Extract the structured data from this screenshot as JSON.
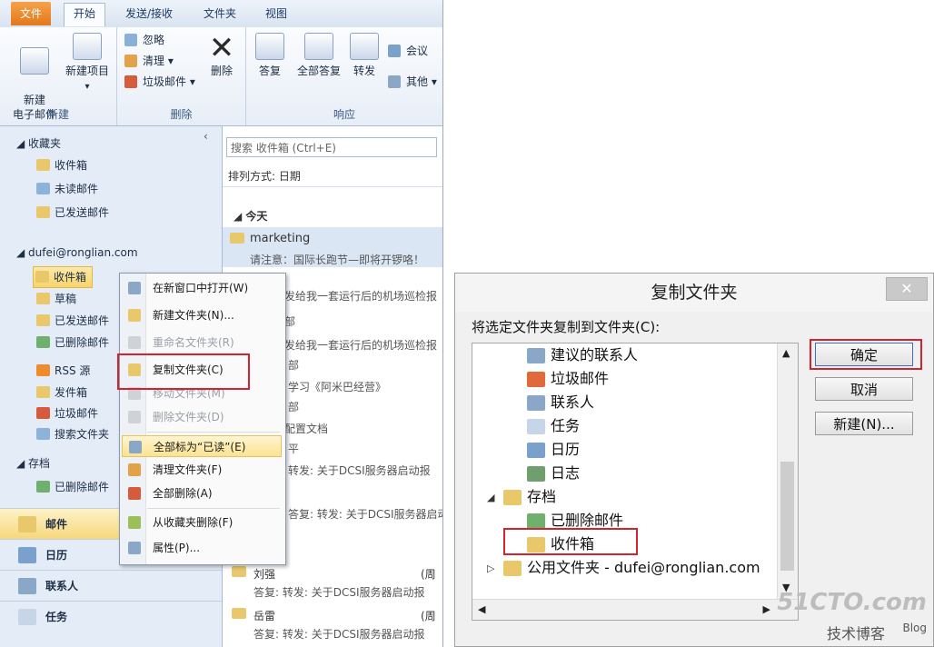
{
  "ribbon": {
    "tabs": [
      "文件",
      "开始",
      "发送/接收",
      "文件夹",
      "视图"
    ],
    "groups": {
      "new": {
        "label": "新建",
        "new_email": "新建\n电子邮件",
        "new_items": "新建项目"
      },
      "delete": {
        "label": "删除",
        "ignore": "忽略",
        "clean": "清理",
        "junk": "垃圾邮件",
        "delete": "删除"
      },
      "respond": {
        "label": "响应",
        "reply": "答复",
        "reply_all": "全部答复",
        "forward": "转发",
        "meeting": "会议",
        "more": "其他"
      }
    }
  },
  "nav": {
    "favorites_header": "收藏夹",
    "favorites": [
      "收件箱",
      "未读邮件",
      "已发送邮件"
    ],
    "account_header": "dufei@ronglian.com",
    "account_items": [
      "收件箱",
      "草稿",
      "已发送邮件",
      "已删除邮件",
      "RSS 源",
      "发件箱",
      "垃圾邮件",
      "搜索文件夹"
    ],
    "archive_header": "存档",
    "archive_items": [
      "已删除邮件"
    ],
    "bottom": [
      "邮件",
      "日历",
      "联系人",
      "任务"
    ]
  },
  "maillist": {
    "search_placeholder": "搜索 收件箱 (Ctrl+E)",
    "sort": "排列方式: 日期",
    "group_today": "今天",
    "first_sender": "marketing",
    "first_preview": "请注意：国际长跑节—即将开锣咯！",
    "partial_previews": [
      "发给我一套运行后的机场巡检报",
      "发给我一套运行后的机场巡检报",
      "部",
      "学习《阿米巴经营》",
      "部",
      "配置文档",
      "部",
      "平",
      "转发: 关于DCSI服务器启动报"
    ],
    "row_sender_1": "刘强",
    "row_sender_2": "岳雷",
    "row_preview": "答复: 转发: 关于DCSI服务器启动报",
    "row_date_marker": "(周"
  },
  "context_menu": {
    "items": [
      {
        "label": "在新窗口中打开(W)",
        "disabled": false
      },
      {
        "label": "新建文件夹(N)...",
        "disabled": false
      },
      {
        "label": "重命名文件夹(R)",
        "disabled": true
      },
      {
        "label": "复制文件夹(C)",
        "disabled": false
      },
      {
        "label": "移动文件夹(M)",
        "disabled": true
      },
      {
        "label": "删除文件夹(D)",
        "disabled": true
      },
      {
        "label": "全部标为“已读”(E)",
        "disabled": false
      },
      {
        "label": "清理文件夹(F)",
        "disabled": false
      },
      {
        "label": "全部删除(A)",
        "disabled": false
      },
      {
        "label": "从收藏夹删除(F)",
        "disabled": false
      },
      {
        "label": "属性(P)...",
        "disabled": false
      }
    ]
  },
  "dialog": {
    "title": "复制文件夹",
    "close": "✕",
    "prompt": "将选定文件夹复制到文件夹(C):",
    "tree": [
      "建议的联系人",
      "垃圾邮件",
      "联系人",
      "任务",
      "日历",
      "日志",
      "存档",
      "已删除邮件",
      "收件箱",
      "公用文件夹 - dufei@ronglian.com"
    ],
    "ok": "确定",
    "cancel": "取消",
    "new": "新建(N)..."
  },
  "watermark": {
    "brand": "51CTO.com",
    "sub": "技术博客",
    "blog": "Blog"
  },
  "colors": {
    "accent_red": "#d3232e",
    "file_tab": "#e3771b",
    "highlight": "#f7d46d"
  }
}
